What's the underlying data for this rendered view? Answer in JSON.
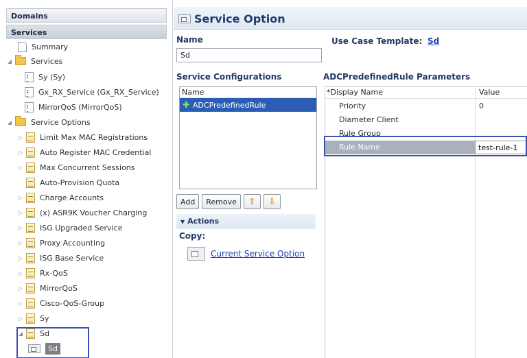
{
  "nav": {
    "domains_label": "Domains",
    "services_label": "Services",
    "tree": {
      "summary": "Summary",
      "services_folder": "Services",
      "services_items": [
        "Sy (Sy)",
        "Gx_RX_Service (Gx_RX_Service)",
        "MirrorQoS (MirrorQoS)"
      ],
      "service_options_folder": "Service Options",
      "service_options_items": [
        "Limit Max MAC Registrations",
        "Auto Register MAC Credential",
        "Max Concurrent Sessions",
        "Auto-Provision Quota",
        "Charge Accounts",
        "(x) ASR9K Voucher Charging",
        "ISG Upgraded Service",
        "Proxy Accounting",
        "ISG Base Service",
        "Rx-QoS",
        "MirrorQoS",
        "Cisco-QoS-Group",
        "Sy",
        "Sd"
      ],
      "sd_child": "Sd"
    }
  },
  "editor": {
    "title": "Service Option",
    "name_label": "Name",
    "name_value": "Sd",
    "use_case_label": "Use Case Template:",
    "use_case_value": "Sd",
    "service_configs_label": "Service Configurations",
    "service_configs_column": "Name",
    "service_configs_items": [
      "ADCPredefinedRule"
    ],
    "buttons": {
      "add": "Add",
      "remove": "Remove"
    },
    "actions_label": "Actions",
    "copy_label": "Copy:",
    "copy_link": "Current Service Option"
  },
  "params": {
    "title": "ADCPredefinedRule Parameters",
    "col_name": "*Display Name",
    "col_value": "Value",
    "rows": [
      {
        "name": "Priority",
        "value": "0"
      },
      {
        "name": "Diameter Client",
        "value": ""
      },
      {
        "name": "Rule Group",
        "value": ""
      },
      {
        "name": "Rule Name",
        "value": "test-rule-1"
      }
    ]
  },
  "colors": {
    "selection_blue": "#2b5db5",
    "highlight_border": "#3a4fb5",
    "header_text": "#1f3c6e",
    "link": "#1b3fb0"
  }
}
